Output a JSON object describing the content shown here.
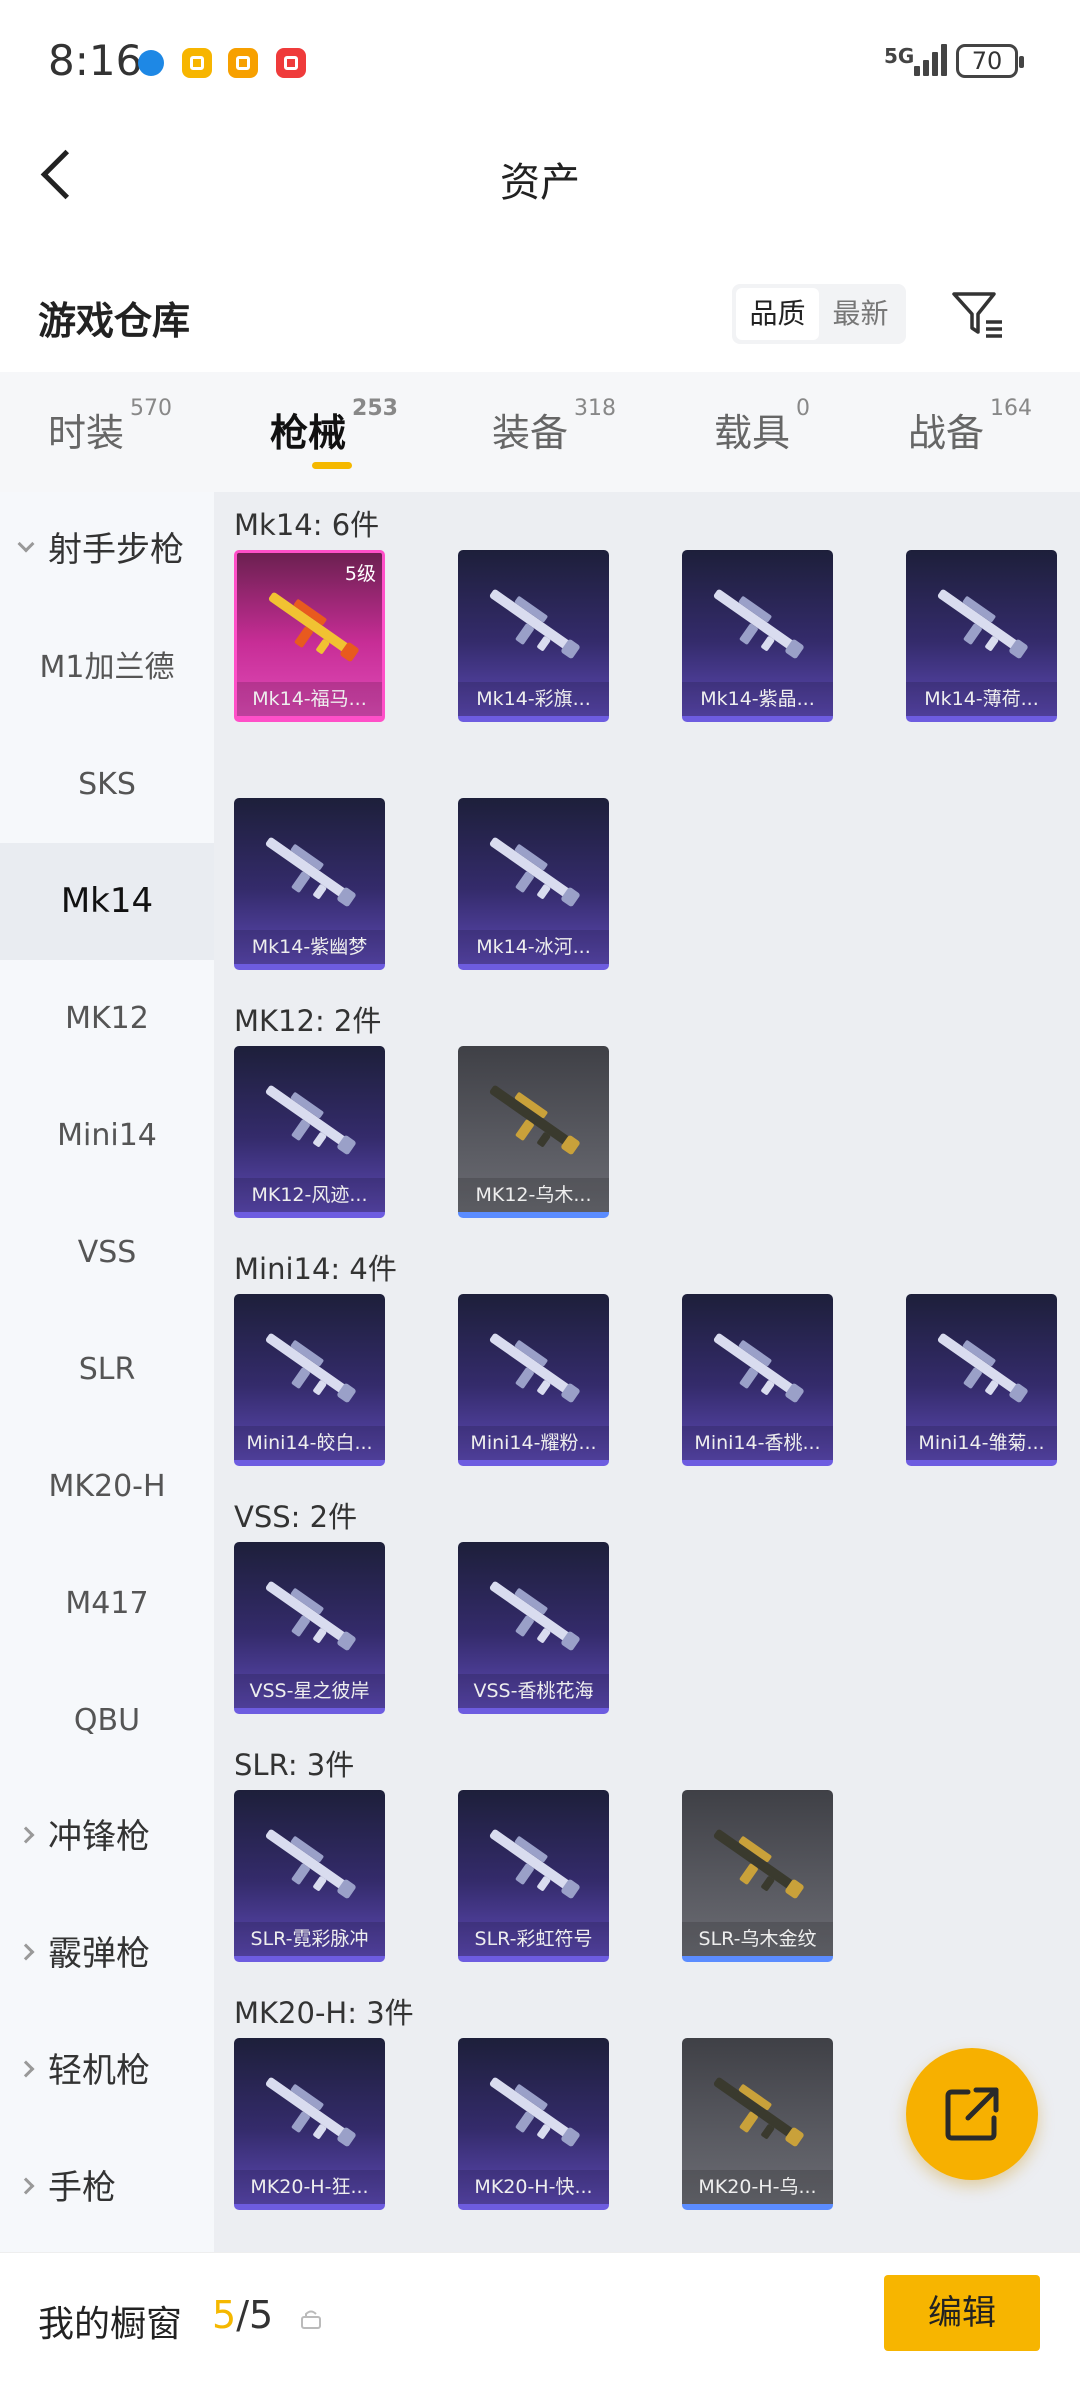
{
  "status_bar": {
    "time": "8:16",
    "network": "5G",
    "battery": "70"
  },
  "header": {
    "title": "资产"
  },
  "warehouse": {
    "title": "游戏仓库",
    "sort_options": [
      "品质",
      "最新"
    ]
  },
  "tabs": [
    {
      "label": "时装",
      "count": "570"
    },
    {
      "label": "枪械",
      "count": "253"
    },
    {
      "label": "装备",
      "count": "318"
    },
    {
      "label": "载具",
      "count": "0"
    },
    {
      "label": "战备",
      "count": "164"
    }
  ],
  "sidebar": [
    {
      "label": "射手步枪"
    },
    {
      "label": "M1加兰德"
    },
    {
      "label": "SKS"
    },
    {
      "label": "Mk14"
    },
    {
      "label": "MK12"
    },
    {
      "label": "Mini14"
    },
    {
      "label": "VSS"
    },
    {
      "label": "SLR"
    },
    {
      "label": "MK20-H"
    },
    {
      "label": "M417"
    },
    {
      "label": "QBU"
    },
    {
      "label": "冲锋枪"
    },
    {
      "label": "霰弹枪"
    },
    {
      "label": "轻机枪"
    },
    {
      "label": "手枪"
    }
  ],
  "sections": [
    {
      "title": "Mk14: 6件",
      "items": [
        {
          "label": "Mk14-福马...",
          "level": "5级",
          "style": "pink"
        },
        {
          "label": "Mk14-彩旗...",
          "style": "purple"
        },
        {
          "label": "Mk14-紫晶...",
          "style": "purple"
        },
        {
          "label": "Mk14-薄荷...",
          "style": "purple"
        },
        {
          "label": "Mk14-紫幽梦",
          "style": "purple"
        },
        {
          "label": "Mk14-冰河...",
          "style": "purple"
        }
      ]
    },
    {
      "title": "MK12: 2件",
      "items": [
        {
          "label": "MK12-风迹...",
          "style": "purple"
        },
        {
          "label": "MK12-乌木...",
          "style": "gray"
        }
      ]
    },
    {
      "title": "Mini14: 4件",
      "items": [
        {
          "label": "Mini14-皎白...",
          "style": "purple"
        },
        {
          "label": "Mini14-耀粉...",
          "style": "purple"
        },
        {
          "label": "Mini14-香桃...",
          "style": "purple"
        },
        {
          "label": "Mini14-雏菊...",
          "style": "purple"
        }
      ]
    },
    {
      "title": "VSS: 2件",
      "items": [
        {
          "label": "VSS-星之彼岸",
          "style": "purple"
        },
        {
          "label": "VSS-香桃花海",
          "style": "purple"
        }
      ]
    },
    {
      "title": "SLR: 3件",
      "items": [
        {
          "label": "SLR-霓彩脉冲",
          "style": "purple"
        },
        {
          "label": "SLR-彩虹符号",
          "style": "purple"
        },
        {
          "label": "SLR-乌木金纹",
          "style": "gray"
        }
      ]
    },
    {
      "title": "MK20-H: 3件",
      "items": [
        {
          "label": "MK20-H-狂...",
          "style": "purple"
        },
        {
          "label": "MK20-H-快...",
          "style": "purple"
        },
        {
          "label": "MK20-H-乌...",
          "style": "gray"
        }
      ]
    }
  ],
  "bottom_bar": {
    "label": "我的橱窗",
    "count_used": "5",
    "count_sep": "/",
    "count_total": "5",
    "edit_label": "编辑"
  },
  "colors": {
    "accent": "#f7b500",
    "rare_pink": "#e04cb8",
    "epic_purple": "#5c49b3"
  },
  "icons": {
    "back": "chevron-left-icon",
    "filter": "filter-icon",
    "share": "share-external-icon",
    "lock": "lock-icon"
  }
}
